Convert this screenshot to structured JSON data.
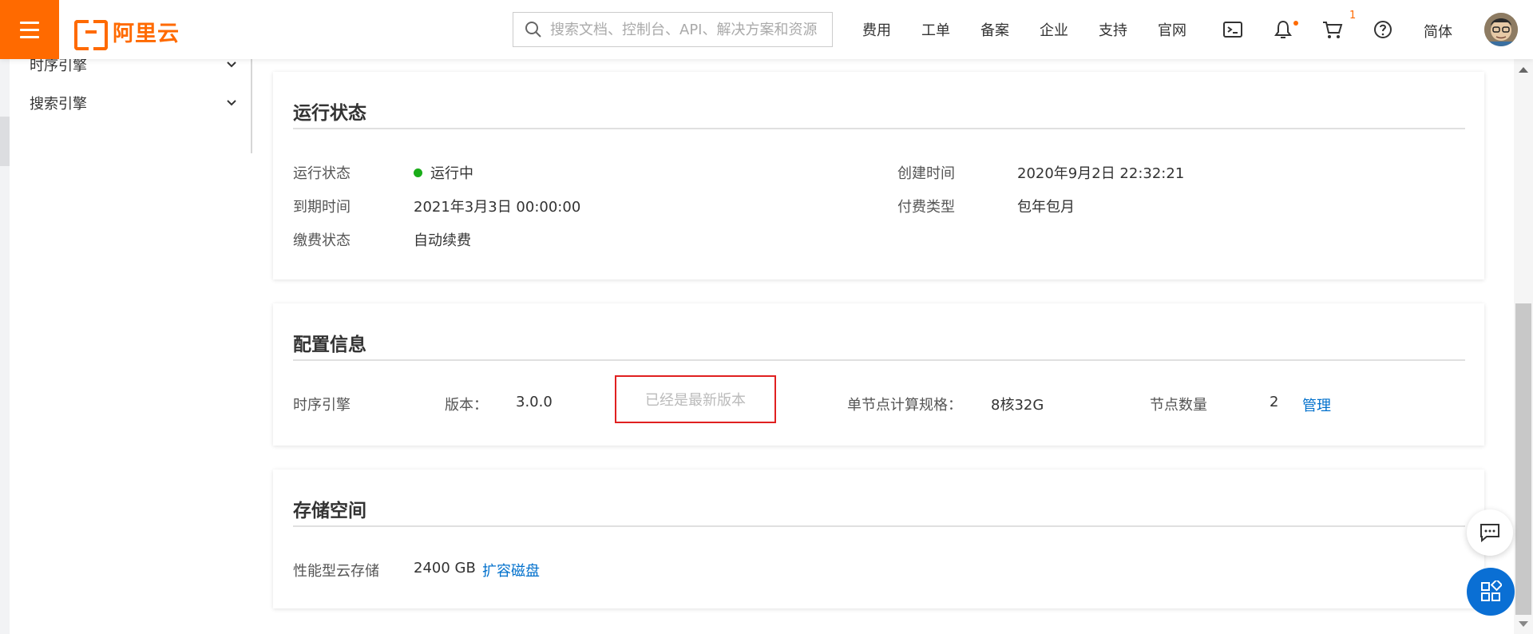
{
  "header": {
    "logo_text": "阿里云",
    "search_placeholder": "搜索文档、控制台、API、解决方案和资源",
    "nav": [
      "费用",
      "工单",
      "备案",
      "企业",
      "支持",
      "官网"
    ],
    "cart_count": "1",
    "language": "简体"
  },
  "sidebar": {
    "items": [
      {
        "label": "时序引擎"
      },
      {
        "label": "搜索引擎"
      }
    ]
  },
  "run_status": {
    "title": "运行状态",
    "status_label": "运行状态",
    "status_value": "运行中",
    "status_color": "#1aad19",
    "create_label": "创建时间",
    "create_value": "2020年9月2日 22:32:21",
    "expire_label": "到期时间",
    "expire_value": "2021年3月3日 00:00:00",
    "pay_type_label": "付费类型",
    "pay_type_value": "包年包月",
    "pay_status_label": "缴费状态",
    "pay_status_value": "自动续费"
  },
  "config": {
    "title": "配置信息",
    "engine": "时序引擎",
    "version_label": "版本：",
    "version_value": "3.0.0",
    "latest_text": "已经是最新版本",
    "spec_label": "单节点计算规格：",
    "spec_value": "8核32G",
    "nodes_label": "节点数量",
    "nodes_value": "2",
    "manage_link": "管理"
  },
  "storage": {
    "title": "存储空间",
    "type_label": "性能型云存储",
    "size_value": "2400 GB",
    "expand_link": "扩容磁盘"
  },
  "colors": {
    "brand": "#ff6a00",
    "link": "#0070cc",
    "highlight_border": "#e02020"
  }
}
